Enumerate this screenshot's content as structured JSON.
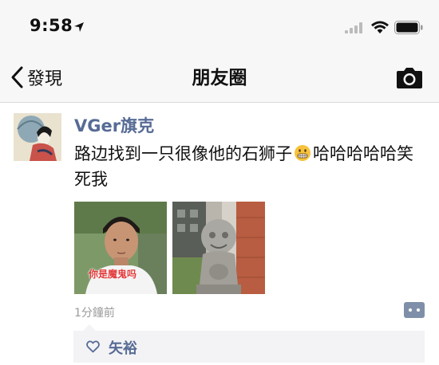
{
  "status_bar": {
    "time": "9:58",
    "icons": [
      "location-arrow-icon",
      "signal-bars-icon",
      "wifi-icon",
      "battery-icon"
    ]
  },
  "nav": {
    "back_label": "發現",
    "title": "朋友圈",
    "right_icon": "camera-icon"
  },
  "post": {
    "username": "VGer旗克",
    "text_before_emoji": "路边找到一只很像他的石狮子",
    "emoji": "grimacing-emoji",
    "text_after_emoji": "哈哈哈哈哈笑死我",
    "photos": [
      {
        "icon": "photo-person",
        "caption": "你是魔鬼吗"
      },
      {
        "icon": "photo-stone-lion"
      }
    ],
    "timestamp": "1分鐘前",
    "likes": [
      "矢裕"
    ]
  },
  "colors": {
    "link": "#576b95",
    "bar_background": "#f7f7f7",
    "likes_background": "#f3f3f5",
    "comment_button": "#7f8fa9"
  }
}
